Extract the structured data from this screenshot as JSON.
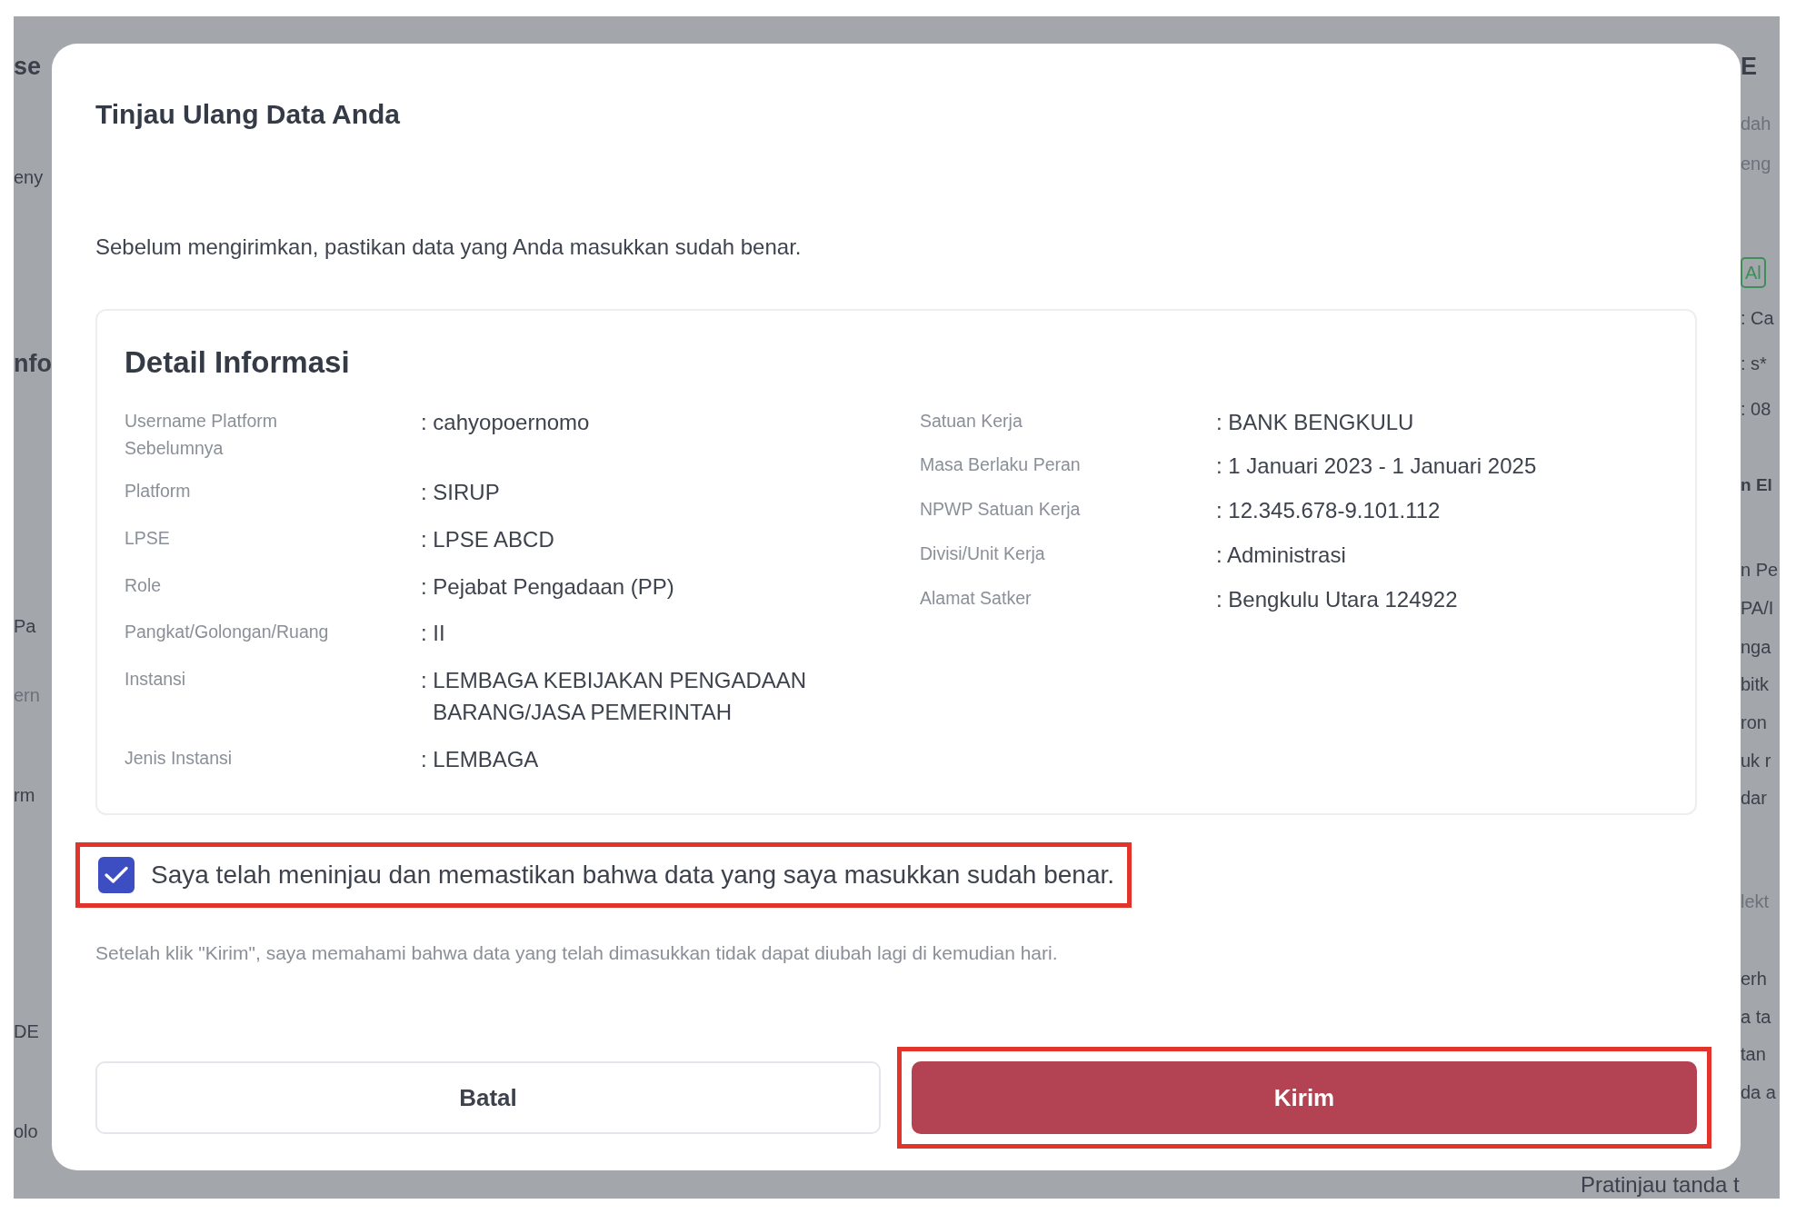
{
  "background": {
    "left_fragments": [
      {
        "text": "se",
        "kind": "heading"
      },
      {
        "text": "eny",
        "kind": "text"
      },
      {
        "text": "nfo",
        "kind": "heading"
      },
      {
        "text": "Pa",
        "kind": "text"
      },
      {
        "text": "ern",
        "kind": "muted"
      },
      {
        "text": "rm",
        "kind": "text"
      },
      {
        "text": "DE",
        "kind": "text"
      },
      {
        "text": "olo",
        "kind": "text"
      }
    ],
    "right_fragments": [
      {
        "text": "E",
        "kind": "heading"
      },
      {
        "text": "dah",
        "kind": "muted"
      },
      {
        "text": "eng",
        "kind": "muted"
      },
      {
        "text": "Al",
        "kind": "badge"
      },
      {
        "text": ": Ca",
        "kind": "text"
      },
      {
        "text": ": s*",
        "kind": "text"
      },
      {
        "text": ": 08",
        "kind": "text"
      },
      {
        "text": "n El",
        "kind": "subheading"
      },
      {
        "text": "n Pe",
        "kind": "text"
      },
      {
        "text": "PA/I",
        "kind": "text"
      },
      {
        "text": "nga",
        "kind": "text"
      },
      {
        "text": "bitk",
        "kind": "text"
      },
      {
        "text": "ron",
        "kind": "text"
      },
      {
        "text": "uk r",
        "kind": "text"
      },
      {
        "text": "dar",
        "kind": "text"
      },
      {
        "text": "lekt",
        "kind": "muted"
      },
      {
        "text": "erh",
        "kind": "text"
      },
      {
        "text": "a ta",
        "kind": "text"
      },
      {
        "text": "tan",
        "kind": "text"
      },
      {
        "text": "da a",
        "kind": "text"
      }
    ],
    "bottom_text": "Pratinjau tanda t"
  },
  "dialog": {
    "title": "Tinjau Ulang Data Anda",
    "intro": "Sebelum mengirimkan, pastikan data yang Anda masukkan sudah benar.",
    "details": {
      "title": "Detail Informasi",
      "left": [
        {
          "label": "Username Platform Sebelumnya",
          "value": ": cahyopoernomo"
        },
        {
          "label": "Platform",
          "value": ": SIRUP"
        },
        {
          "label": "LPSE",
          "value": ": LPSE ABCD"
        },
        {
          "label": "Role",
          "value": ": Pejabat Pengadaan (PP)"
        },
        {
          "label": "Pangkat/Golongan/Ruang",
          "value": ": II"
        },
        {
          "label": "Instansi",
          "value": ": LEMBAGA KEBIJAKAN PENGADAAN BARANG/JASA PEMERINTAH"
        },
        {
          "label": "Jenis Instansi",
          "value": ": LEMBAGA"
        }
      ],
      "right": [
        {
          "label": "Satuan Kerja",
          "value": ": BANK BENGKULU"
        },
        {
          "label": "Masa Berlaku Peran",
          "value": ": 1 Januari 2023 - 1 Januari 2025"
        },
        {
          "label": "NPWP Satuan Kerja",
          "value": " : 12.345.678-9.101.112"
        },
        {
          "label": "Divisi/Unit Kerja",
          "value": ": Administrasi"
        },
        {
          "label": "Alamat Satker",
          "value": ": Bengkulu Utara 124922"
        }
      ]
    },
    "confirm": {
      "label": "Saya telah meninjau dan memastikan bahwa data yang saya masukkan sudah benar.",
      "checked": true,
      "highlighted": true
    },
    "note": "Setelah klik \"Kirim\", saya memahami bahwa data yang telah dimasukkan tidak dapat diubah lagi di kemudian hari.",
    "buttons": [
      {
        "label": "Batal",
        "kind": "secondary",
        "highlighted": false
      },
      {
        "label": "Kirim",
        "kind": "primary",
        "highlighted": true
      }
    ]
  }
}
